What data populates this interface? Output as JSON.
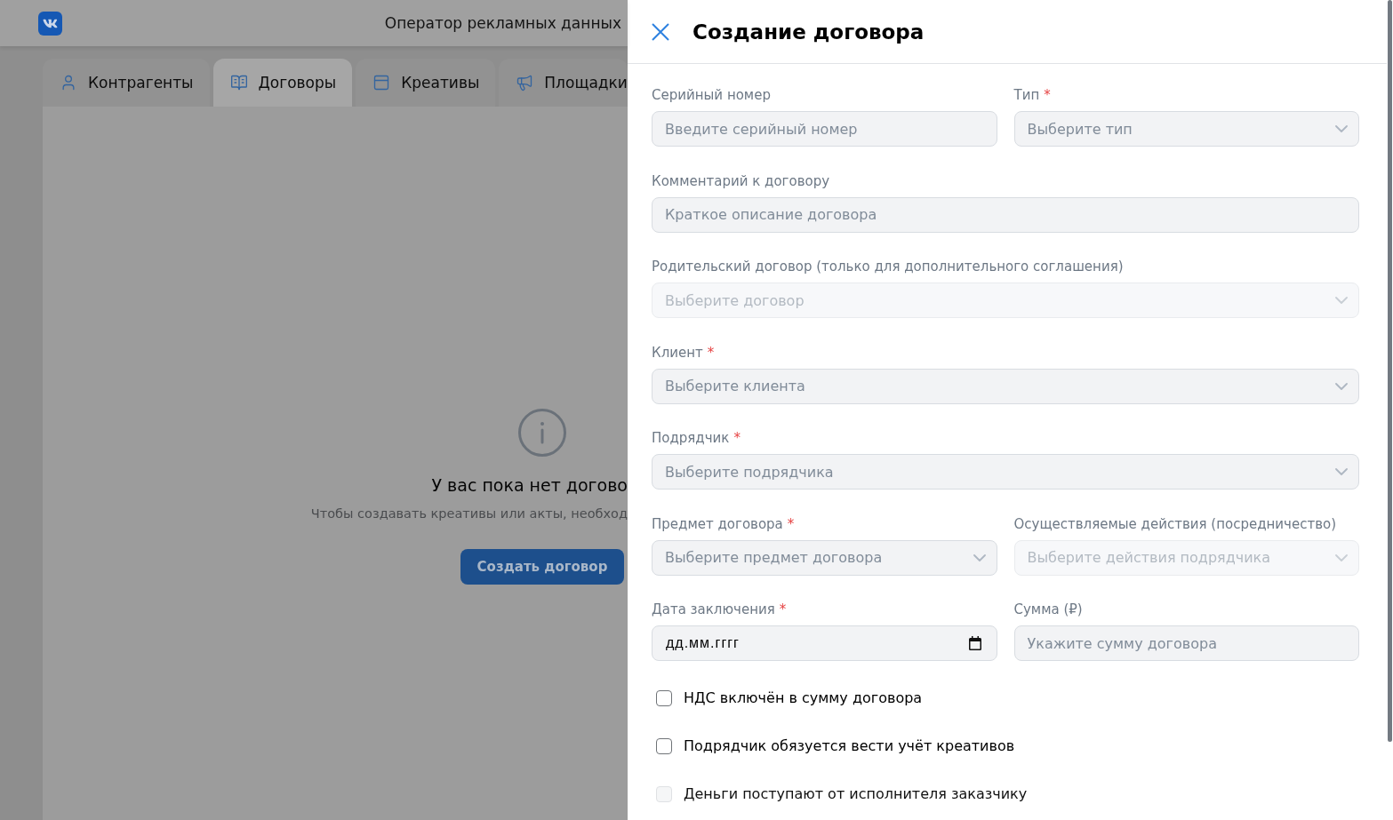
{
  "header": {
    "title": "Оператор рекламных данных"
  },
  "tabs": [
    {
      "label": "Контрагенты",
      "selected": false
    },
    {
      "label": "Договоры",
      "selected": true
    },
    {
      "label": "Креативы",
      "selected": false
    },
    {
      "label": "Площадки",
      "selected": false
    }
  ],
  "empty_state": {
    "title": "У вас пока нет догово",
    "text": "Чтобы создавать креативы или акты, необход",
    "button": "Создать договор"
  },
  "drawer": {
    "title": "Создание договора",
    "rows": [
      [
        {
          "label": "Серийный номер",
          "kind": "input",
          "placeholder": "Введите серийный номер",
          "disabled": false
        },
        {
          "label": "Тип",
          "required_mark": "*",
          "kind": "select",
          "placeholder": "Выберите тип",
          "disabled": false
        }
      ],
      [
        {
          "label": "Комментарий к договору",
          "kind": "input",
          "placeholder": "Краткое описание договора",
          "disabled": false
        }
      ],
      [
        {
          "label": "Родительский договор (только для дополнительного соглашения)",
          "kind": "select",
          "placeholder": "Выберите договор",
          "disabled": true
        }
      ],
      [
        {
          "label": "Клиент",
          "required_mark": "*",
          "kind": "select",
          "placeholder": "Выберите клиента",
          "disabled": false
        }
      ],
      [
        {
          "label": "Подрядчик",
          "required_mark": "*",
          "kind": "select",
          "placeholder": "Выберите подрядчика",
          "disabled": false
        }
      ],
      [
        {
          "label": "Предмет договора",
          "required_mark": "*",
          "kind": "select",
          "placeholder": "Выберите предмет договора",
          "disabled": false
        },
        {
          "label": "Осуществляемые действия (посредничество)",
          "kind": "select",
          "placeholder": "Выберите действия подрядчика",
          "disabled": true
        }
      ],
      [
        {
          "label": "Дата заключения",
          "required_mark": "*",
          "kind": "date",
          "placeholder": "дд.мм.гггг",
          "disabled": false
        },
        {
          "label": "Сумма (₽)",
          "kind": "input",
          "placeholder": "Укажите сумму договора",
          "disabled": false
        }
      ]
    ],
    "checkboxes": [
      {
        "label": "НДС включён в сумму договора",
        "checked": false,
        "disabled": false
      },
      {
        "label": "Подрядчик обязуется вести учёт креативов",
        "checked": false,
        "disabled": false
      },
      {
        "label": "Деньги поступают от исполнителя заказчику",
        "checked": false,
        "disabled": true
      }
    ]
  }
}
